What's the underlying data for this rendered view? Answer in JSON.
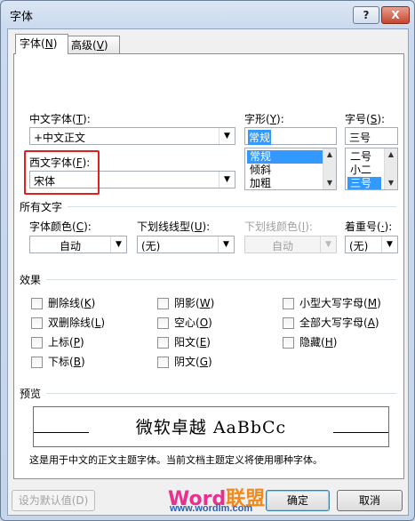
{
  "window": {
    "title": "字体",
    "help": "?",
    "close": "X"
  },
  "tabs": [
    {
      "label": "字体",
      "hotkey": "N"
    },
    {
      "label": "高级",
      "hotkey": "V"
    }
  ],
  "cn_font": {
    "label": "中文字体",
    "hotkey": "T",
    "value": "+中文正文"
  },
  "west_font": {
    "label": "西文字体",
    "hotkey": "F",
    "value": "宋体"
  },
  "style": {
    "label": "字形",
    "hotkey": "Y",
    "value": "常规",
    "options": [
      "常规",
      "倾斜",
      "加粗"
    ]
  },
  "size": {
    "label": "字号",
    "hotkey": "S",
    "value": "三号",
    "options": [
      "二号",
      "小二",
      "三号"
    ]
  },
  "all_text": {
    "label": "所有文字"
  },
  "font_color": {
    "label": "字体颜色",
    "hotkey": "C",
    "value": "自动"
  },
  "underline_type": {
    "label": "下划线线型",
    "hotkey": "U",
    "value": "(无)"
  },
  "underline_color": {
    "label": "下划线颜色",
    "hotkey": "I",
    "value": "自动"
  },
  "emphasis": {
    "label": "着重号",
    "hotkey": "·",
    "value": "(无)"
  },
  "effects": {
    "label": "效果",
    "items": [
      {
        "label": "删除线",
        "hotkey": "K"
      },
      {
        "label": "双删除线",
        "hotkey": "L"
      },
      {
        "label": "上标",
        "hotkey": "P"
      },
      {
        "label": "下标",
        "hotkey": "B"
      },
      {
        "label": "阴影",
        "hotkey": "W"
      },
      {
        "label": "空心",
        "hotkey": "O"
      },
      {
        "label": "阳文",
        "hotkey": "E"
      },
      {
        "label": "阴文",
        "hotkey": "G"
      },
      {
        "label": "小型大写字母",
        "hotkey": "M"
      },
      {
        "label": "全部大写字母",
        "hotkey": "A"
      },
      {
        "label": "隐藏",
        "hotkey": "H"
      }
    ]
  },
  "preview": {
    "label": "预览",
    "sample": "微软卓越  AaBbCc",
    "note": "这是用于中文的正文主题字体。当前文档主题定义将使用哪种字体。"
  },
  "buttons": {
    "set_default": "设为默认值(D)",
    "ok": "确定",
    "cancel": "取消"
  },
  "logo": {
    "word": "Word",
    "cn": "联盟",
    "url": "www.wordlm.com"
  },
  "colors": {
    "selection": "#3399ff",
    "highlight_border": "#e02020"
  }
}
